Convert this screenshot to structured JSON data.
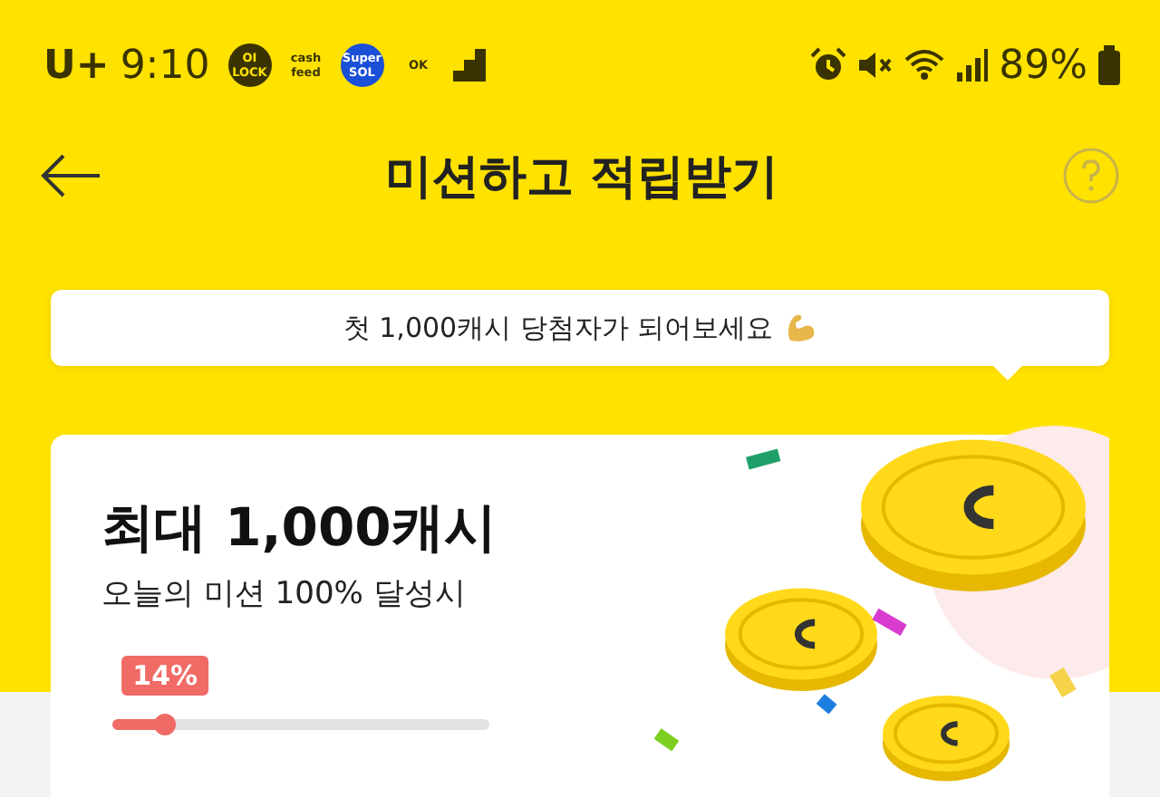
{
  "status_bar": {
    "carrier": "U+",
    "time": "9:10",
    "app_icons": [
      {
        "label": "OI LOCK",
        "kind": "dark"
      },
      {
        "label": "cash feed",
        "kind": "plain"
      },
      {
        "label": "Super SOL",
        "kind": "blue"
      },
      {
        "label": "OK",
        "kind": "plain"
      }
    ],
    "battery": "89%"
  },
  "header": {
    "title": "미션하고 적립받기"
  },
  "banner": {
    "text": "첫 1,000캐시 당첨자가 되어보세요"
  },
  "card": {
    "title": "최대 1,000캐시",
    "subtitle": "오늘의 미션 100% 달성시",
    "progress": {
      "label": "14%",
      "level": 0.14
    }
  }
}
